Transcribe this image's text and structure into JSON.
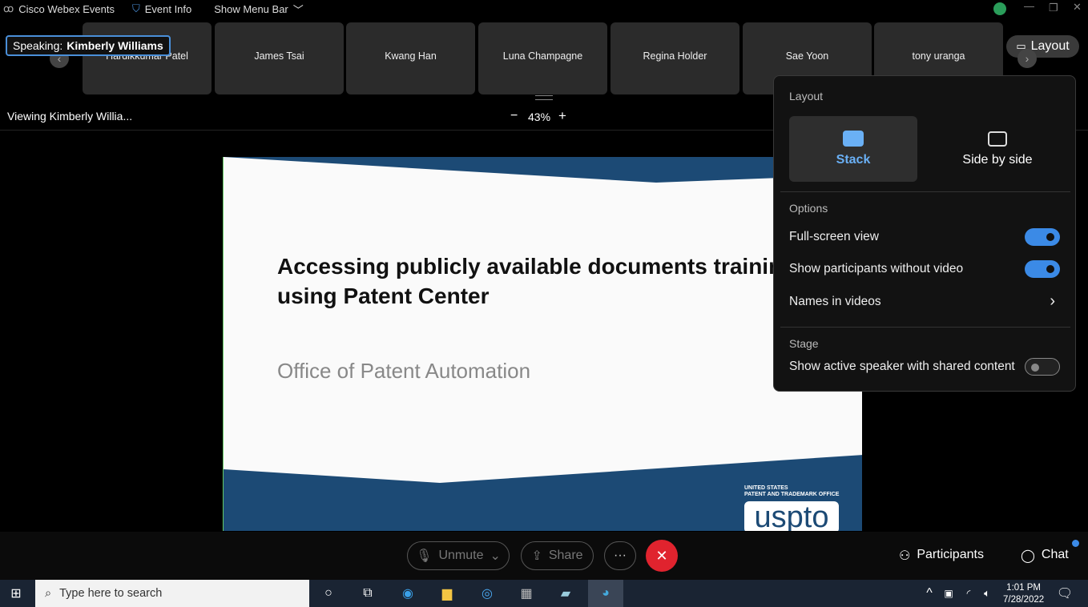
{
  "app": {
    "title": "Cisco Webex Events",
    "event_info": "Event Info",
    "show_menu_bar": "Show Menu Bar"
  },
  "speaking": {
    "label": "Speaking:",
    "name": "Kimberly Williams"
  },
  "participants_strip": [
    "Hardikkumar Patel",
    "James Tsai",
    "Kwang Han",
    "Luna Champagne",
    "Regina Holder",
    "Sae Yoon",
    "tony uranga"
  ],
  "layout_button": "Layout",
  "viewing": "Viewing Kimberly Willia...",
  "zoom": {
    "value": "43%",
    "minus": "−",
    "plus": "+"
  },
  "slide": {
    "title_line1": "Accessing publicly available documents training",
    "title_line2": "using Patent Center",
    "subtitle": "Office of Patent Automation",
    "logo_top": "UNITED STATES",
    "logo_mid": "PATENT AND TRADEMARK OFFICE",
    "logo": "uspto"
  },
  "layout_popup": {
    "header": "Layout",
    "stack": "Stack",
    "side_by_side": "Side by side",
    "options_header": "Options",
    "full_screen": "Full-screen view",
    "full_screen_on": true,
    "show_without_video": "Show participants without video",
    "show_without_video_on": true,
    "names_in_videos": "Names in videos",
    "stage_header": "Stage",
    "active_speaker": "Show active speaker with shared content",
    "active_speaker_on": false
  },
  "controls": {
    "unmute": "Unmute",
    "share": "Share",
    "more": "···",
    "participants": "Participants",
    "chat": "Chat"
  },
  "taskbar": {
    "search_placeholder": "Type here to search",
    "time": "1:01 PM",
    "date": "7/28/2022"
  },
  "colors": {
    "accent": "#3b8ae6",
    "end_call": "#e0232e",
    "slide_blue": "#1c4a75"
  }
}
